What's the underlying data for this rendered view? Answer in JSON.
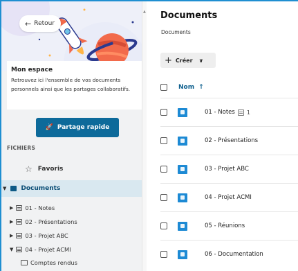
{
  "sidebar": {
    "back_label": "Retour",
    "info_title": "Mon espace",
    "info_text": "Retrouvez ici l'ensemble de vos documents personnels ainsi que les partages collaboratifs.",
    "share_label": "Partage rapide",
    "section_label": "FICHIERS",
    "favoris_label": "Favoris",
    "documents_label": "Documents",
    "tree": [
      {
        "label": "01 - Notes"
      },
      {
        "label": "02 - Présentations"
      },
      {
        "label": "03 - Projet ABC"
      },
      {
        "label": "04 - Projet ACMI"
      },
      {
        "label": "Comptes rendus"
      }
    ]
  },
  "main": {
    "title": "Documents",
    "breadcrumb": "Documents",
    "create_label": "Créer",
    "column_name": "Nom",
    "rows": [
      {
        "label": "01 - Notes",
        "note_count": "1"
      },
      {
        "label": "02 - Présentations"
      },
      {
        "label": "03 - Projet ABC"
      },
      {
        "label": "04 - Projet ACMI"
      },
      {
        "label": "05 - Réunions"
      },
      {
        "label": "06 - Documentation"
      }
    ]
  },
  "colors": {
    "accent": "#1f8fd1",
    "button": "#0d6a9a",
    "selected_bg": "#d9e8f0",
    "folder": "#1d8ad4"
  }
}
